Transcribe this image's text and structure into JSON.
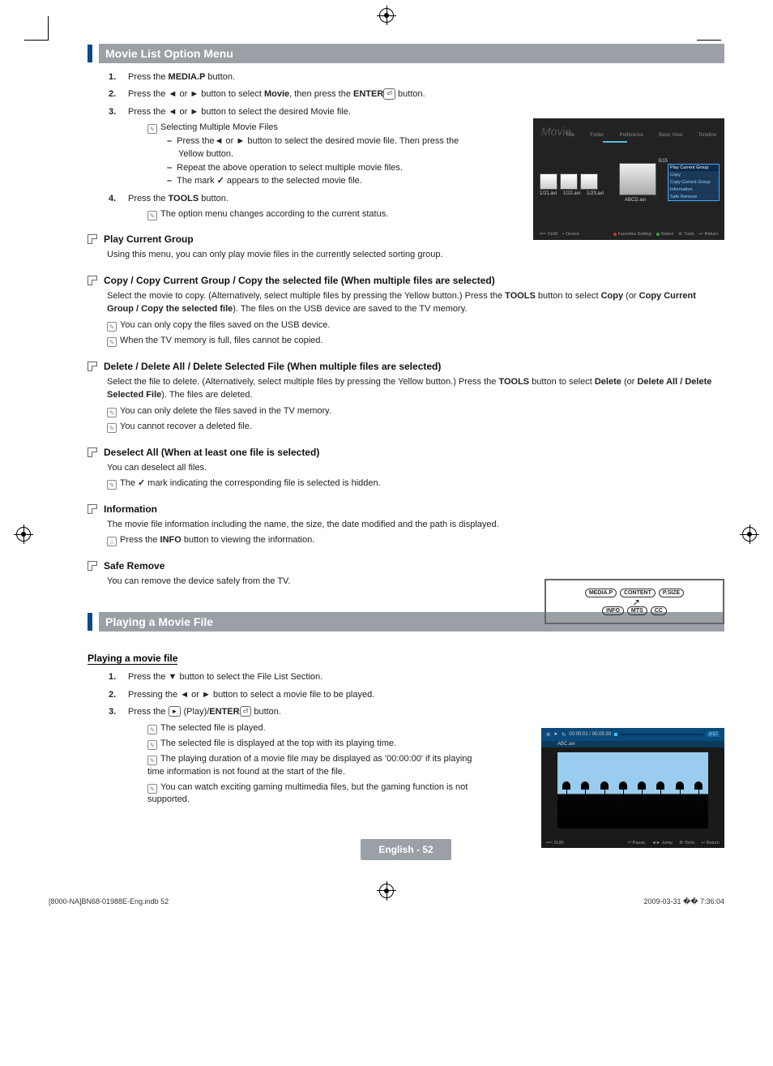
{
  "sections": {
    "movie_list_title": "Movie List Option Menu",
    "playing_title": "Playing a Movie File"
  },
  "steps": {
    "s1_pre": "Press the ",
    "s1_btn": "MEDIA.P",
    "s1_post": " button.",
    "s2_pre": "Press the ",
    "s2_mid1": " or ",
    "s2_mid2": " button to select ",
    "s2_movie": "Movie",
    "s2_then": ", then press the ",
    "s2_enter": "ENTER",
    "s2_post": " button.",
    "s3_pre": "Press the ",
    "s3_mid1": " or ",
    "s3_post": " button to select the desired Movie file.",
    "s3_sub_title": "Selecting Multiple Movie Files",
    "s3_sub1_a": "Press the",
    "s3_sub1_b": " or ",
    "s3_sub1_c": " button to select the desired movie file. Then press the Yellow button.",
    "s3_sub2": "Repeat the above operation to select multiple movie files.",
    "s3_sub3_a": "The mark ",
    "s3_sub3_b": " appears to the selected movie file.",
    "s4_pre": "Press the ",
    "s4_btn": "TOOLS",
    "s4_post": " button.",
    "s4_sub": "The option menu changes according to the current status."
  },
  "q1": {
    "title": "Play Current Group",
    "body": "Using this menu, you can only play movie files in the currently selected sorting group."
  },
  "q2": {
    "title": "Copy / Copy Current Group / Copy the selected file (When multiple files are selected)",
    "body_a": "Select the movie to copy. (Alternatively, select multiple files by pressing the Yellow button.) Press the ",
    "body_tools": "TOOLS",
    "body_b": " button to select ",
    "body_copy": "Copy",
    "body_c": " (or ",
    "body_copy2": "Copy Current Group / Copy the selected file",
    "body_d": "). The files on the USB device are saved to the TV memory.",
    "note1": "You can only copy the files saved on the USB device.",
    "note2": "When the TV memory is full, files cannot be copied."
  },
  "q3": {
    "title": "Delete / Delete All / Delete Selected File (When multiple files are selected)",
    "body_a": "Select the file to delete. (Alternatively, select multiple files by pressing the Yellow button.) Press the ",
    "body_tools": "TOOLS",
    "body_b": " button to select ",
    "body_del": "Delete",
    "body_c": " (or ",
    "body_del2": "Delete All / Delete Selected File",
    "body_d": "). The files are deleted.",
    "note1": "You can only delete the files saved in the TV memory.",
    "note2": "You cannot recover a deleted file."
  },
  "q4": {
    "title": "Deselect All (When at least one file is selected)",
    "body": "You can deselect all files.",
    "note_a": "The ",
    "note_b": " mark indicating the corresponding file is selected is hidden."
  },
  "q5": {
    "title": "Information",
    "body": "The movie file information including the name, the size, the date modified and the path is displayed.",
    "note_a": "Press the ",
    "note_btn": "INFO",
    "note_b": " button to viewing the information."
  },
  "q6": {
    "title": "Safe Remove",
    "body": "You can remove the device safely from the TV."
  },
  "subhead": "Playing a movie file",
  "play": {
    "p1_a": "Press the ",
    "p1_b": " button to select the File List Section.",
    "p2_a": "Pressing the ",
    "p2_b": " or ",
    "p2_c": " button to select a movie file to be played.",
    "p3_a": "Press the ",
    "p3_b": " (Play)/",
    "p3_enter": "ENTER",
    "p3_c": " button.",
    "n1": "The selected file is played.",
    "n2": "The selected file is displayed at the top with its playing time.",
    "n3": "The playing duration of a movie file may be displayed as '00:00:00' if its playing time information is not found at the start of the file.",
    "n4": "You can watch exciting gaming multimedia files, but the gaming function is not supported."
  },
  "fig1": {
    "brand": "Movie",
    "tabs": [
      "Title",
      "Folder",
      "Preference",
      "Basic View",
      "Timeline"
    ],
    "thumbs": [
      "1/21.avi",
      "1/22.avi",
      "1/23.avi"
    ],
    "big": "ABCD.avi",
    "page": "5/15",
    "menu_head": "Play Current Group",
    "menu_items": [
      "Copy",
      "Copy Current Group",
      "Information",
      "Safe Remove"
    ],
    "foot_sum": "SUM",
    "foot_dev": "Device",
    "foot_fav": "Favorites Setting",
    "foot_sel": "Select",
    "foot_tools": "Tools",
    "foot_ret": "Return"
  },
  "remote": {
    "b1": "MEDIA.P",
    "b2": "CONTENT",
    "b3": "P.SIZE",
    "b4": "INFO",
    "b5": "MTS",
    "b6": "CC"
  },
  "player": {
    "time": "00:00:01 / 00:05:30",
    "page": "3/37",
    "file": "ABC.avi",
    "sum": "SUM",
    "pause": "Pause",
    "jump": "Jump",
    "tools": "Tools",
    "ret": "Return"
  },
  "footer_badge": "English - 52",
  "print_left": "[8000-NA]BN68-01988E-Eng.indb   52",
  "print_right": "2009-03-31   �� 7:36:04"
}
